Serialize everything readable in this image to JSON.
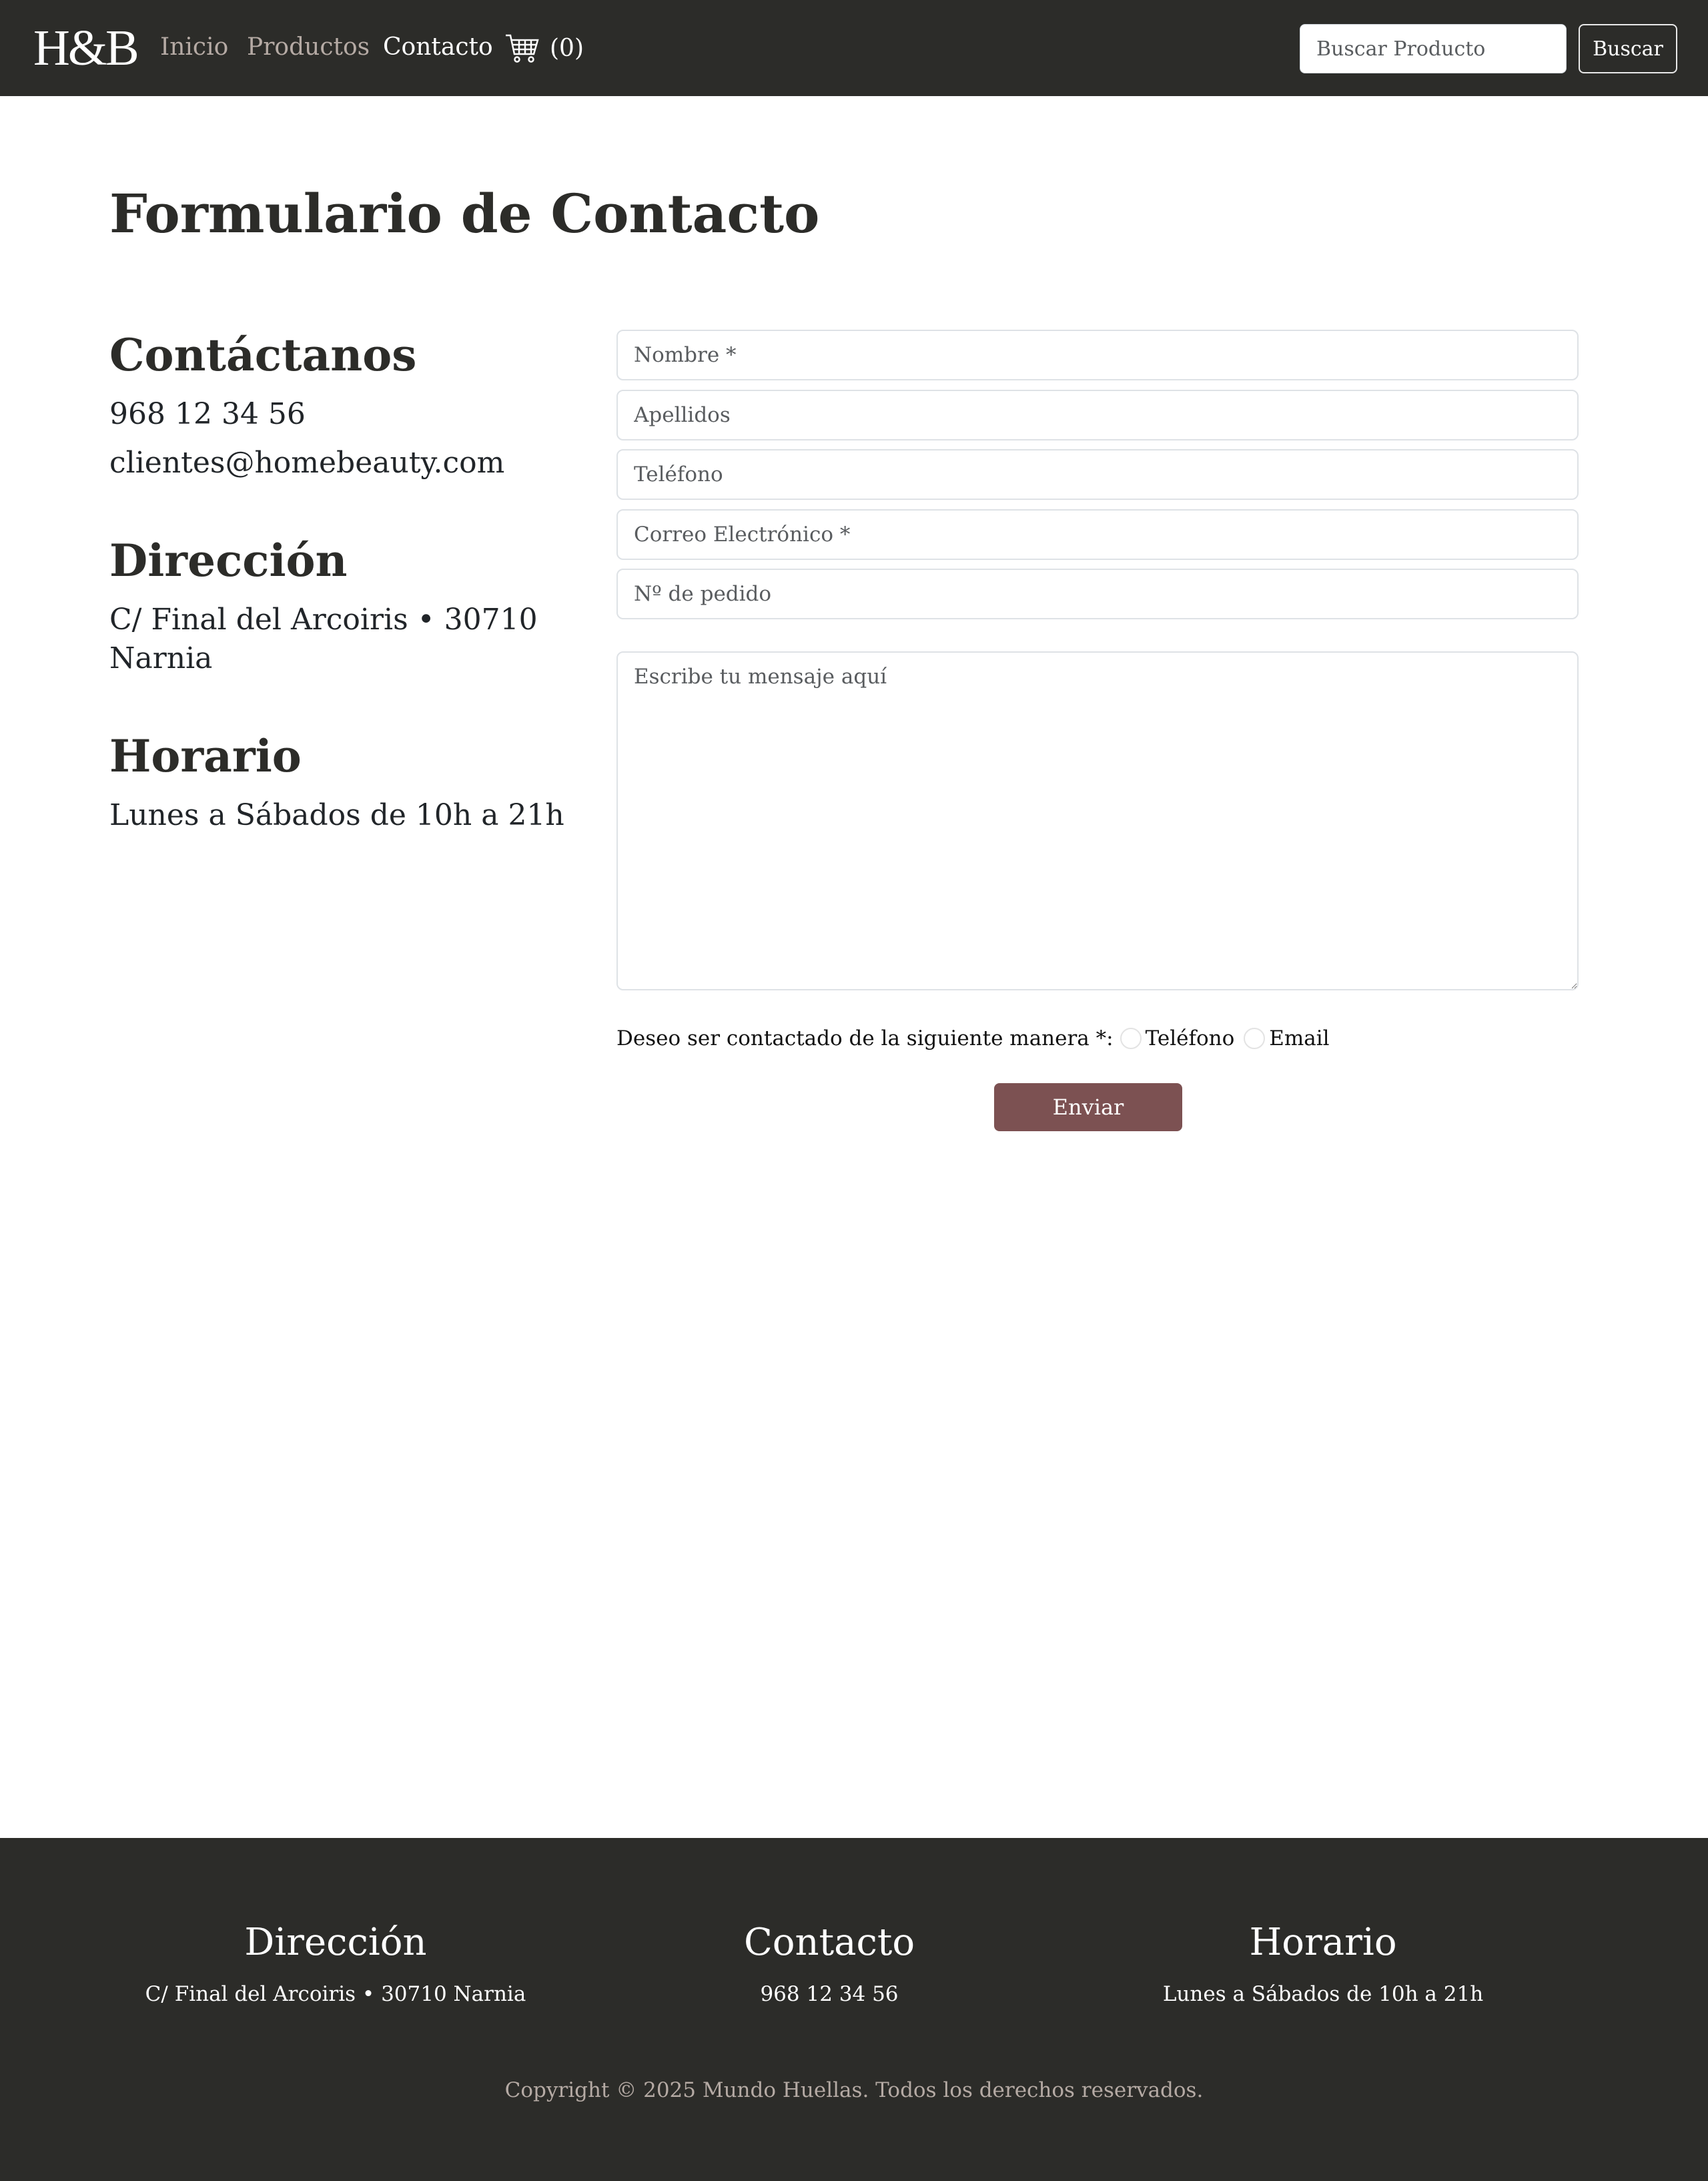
{
  "navbar": {
    "brand": "H&B",
    "links": [
      {
        "label": "Inicio",
        "active": false
      },
      {
        "label": "Productos",
        "active": false
      },
      {
        "label": "Contacto",
        "active": true
      }
    ],
    "cart_count": "(0)",
    "search_placeholder": "Buscar Producto",
    "search_button": "Buscar"
  },
  "main": {
    "title": "Formulario de Contacto",
    "contact_heading": "Contáctanos",
    "phone": "968 12 34 56",
    "email": "clientes@homebeauty.com",
    "address_heading": "Dirección",
    "address_line1": "C/ Final del Arcoiris • 30710",
    "address_line2": "Narnia",
    "hours_heading": "Horario",
    "hours": "Lunes a Sábados de 10h a 21h"
  },
  "form": {
    "name_placeholder": "Nombre *",
    "surname_placeholder": "Apellidos",
    "phone_placeholder": "Teléfono",
    "email_placeholder": "Correo Electrónico *",
    "order_placeholder": "Nº de pedido",
    "message_placeholder": "Escribe tu mensaje aquí",
    "contact_pref_label": "Deseo ser contactado de la siguiente manera *:",
    "option_phone": "Teléfono",
    "option_email": "Email",
    "submit": "Enviar"
  },
  "footer": {
    "address_heading": "Dirección",
    "address": "C/ Final del Arcoiris • 30710 Narnia",
    "contact_heading": "Contacto",
    "phone": "968 12 34 56",
    "hours_heading": "Horario",
    "hours": "Lunes a Sábados de 10h a 21h",
    "copyright": "Copyright © 2025 Mundo Huellas. Todos los derechos reservados."
  },
  "colors": {
    "navbar_bg": "#2c2c29",
    "accent": "#7c5152",
    "nav_link": "#b5aaa4"
  },
  "icons": [
    "shopping-cart-icon"
  ]
}
